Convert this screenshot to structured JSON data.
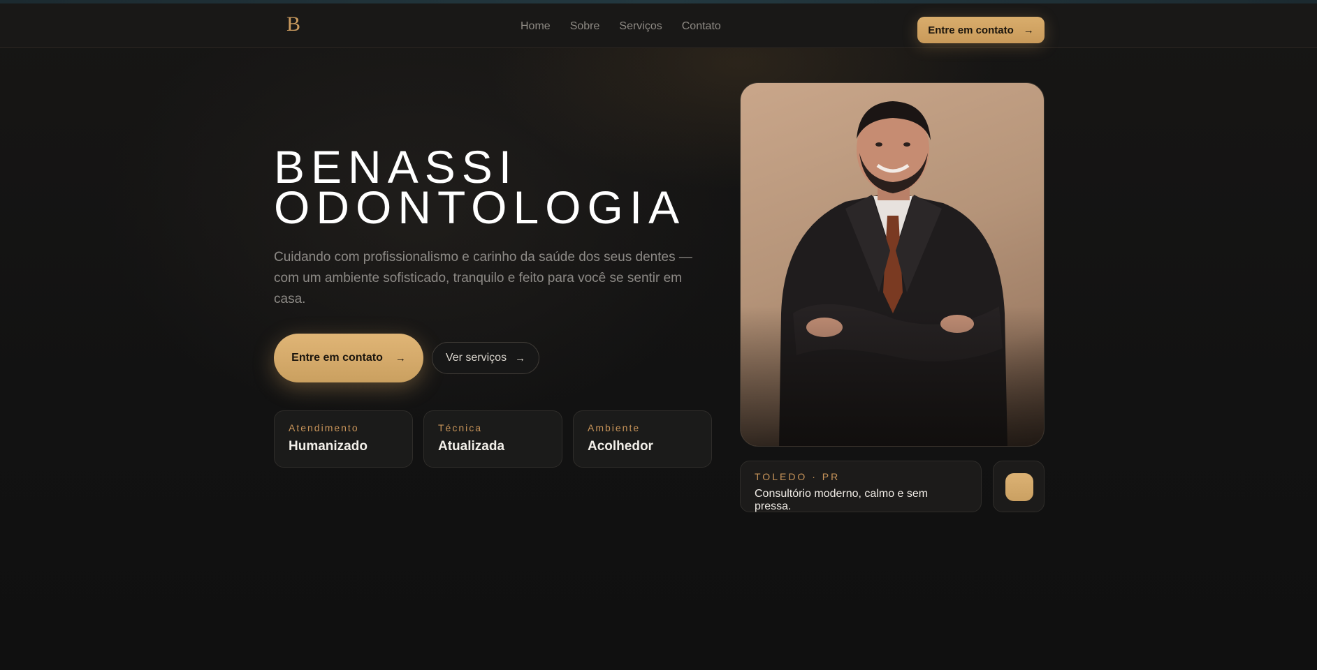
{
  "header": {
    "logo_text": "B",
    "nav": [
      "Home",
      "Sobre",
      "Serviços",
      "Contato"
    ],
    "cta_label": "Entre em contato",
    "cta_icon": "arrow-right-icon"
  },
  "hero": {
    "title_line1": "BENASSI",
    "title_line2": "ODONTOLOGIA",
    "subtitle": "Cuidando com profissionalismo e carinho da saúde dos seus dentes — com um ambiente sofisticado, tranquilo e feito para você se sentir em casa.",
    "primary_button": "Entre em contato",
    "secondary_button": "Ver serviços"
  },
  "features": [
    {
      "label": "Atendimento",
      "value": "Humanizado"
    },
    {
      "label": "Técnica",
      "value": "Atualizada"
    },
    {
      "label": "Ambiente",
      "value": "Acolhedor"
    }
  ],
  "location": {
    "place": "TOLEDO · PR",
    "description": "Consultório moderno, calmo e sem pressa."
  },
  "colors": {
    "accent": "#d9ad6c",
    "background": "#121212",
    "card": "#1b1b1a",
    "label": "#c9955a"
  }
}
